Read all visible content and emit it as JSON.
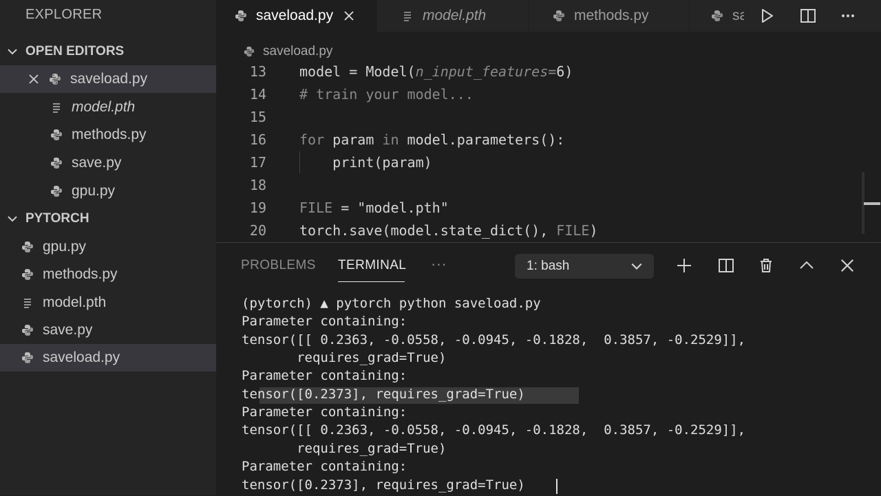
{
  "sidebar": {
    "title": "EXPLORER",
    "open_editors": {
      "header": "OPEN EDITORS",
      "items": [
        {
          "label": "saveload.py"
        },
        {
          "label": "model.pth"
        },
        {
          "label": "methods.py"
        },
        {
          "label": "save.py"
        },
        {
          "label": "gpu.py"
        }
      ]
    },
    "project": {
      "header": "PYTORCH",
      "items": [
        {
          "label": "gpu.py"
        },
        {
          "label": "methods.py"
        },
        {
          "label": "model.pth"
        },
        {
          "label": "save.py"
        },
        {
          "label": "saveload.py"
        }
      ]
    }
  },
  "tabs": [
    {
      "label": "saveload.py"
    },
    {
      "label": "model.pth"
    },
    {
      "label": "methods.py"
    },
    {
      "label": "sa"
    }
  ],
  "editor": {
    "breadcrumb": "saveload.py",
    "lines": [
      {
        "num": "13",
        "t1": "model = Model(",
        "t2": "n_input_features=",
        "t3": "6)"
      },
      {
        "num": "14",
        "t1": "# train your model..."
      },
      {
        "num": "15"
      },
      {
        "num": "16",
        "t1": "for",
        "t2": " param ",
        "t3": "in",
        "t4": " model.parameters():"
      },
      {
        "num": "17",
        "t1": "    print(param)"
      },
      {
        "num": "18"
      },
      {
        "num": "19",
        "t1": "FILE",
        "t2": " = \"model.pth\""
      },
      {
        "num": "20",
        "t1": "torch.save(model.state_dict(), ",
        "t2": "FILE",
        "t3": ")"
      }
    ]
  },
  "panel": {
    "tabs": {
      "problems": "PROBLEMS",
      "terminal": "TERMINAL",
      "more": "···"
    },
    "terminal_select": "1: bash",
    "terminal_lines": [
      "(pytorch) ▲ pytorch python saveload.py",
      "Parameter containing:",
      "tensor([[ 0.2363, -0.0558, -0.0945, -0.1828,  0.3857, -0.2529]],",
      "       requires_grad=True)",
      "Parameter containing:",
      "tensor([0.2373], requires_grad=True)",
      "Parameter containing:",
      "tensor([[ 0.2363, -0.0558, -0.0945, -0.1828,  0.3857, -0.2529]],",
      "       requires_grad=True)",
      "Parameter containing:",
      "tensor([0.2373], requires_grad=True)"
    ]
  },
  "icons": {
    "python": "python-file-icon",
    "plain": "plain-file-icon",
    "close": "close-icon",
    "chevron": "chevron-down-icon",
    "run": "run-icon",
    "split": "split-editor-icon",
    "more": "more-icon",
    "add": "add-icon",
    "trash": "trash-icon",
    "maximize": "chevron-up-icon"
  },
  "colors": {
    "background": "#1e1e1e",
    "sidebar": "#252526",
    "selection": "#37373d",
    "text": "#d4d4d4",
    "muted": "#8a8a8a"
  }
}
